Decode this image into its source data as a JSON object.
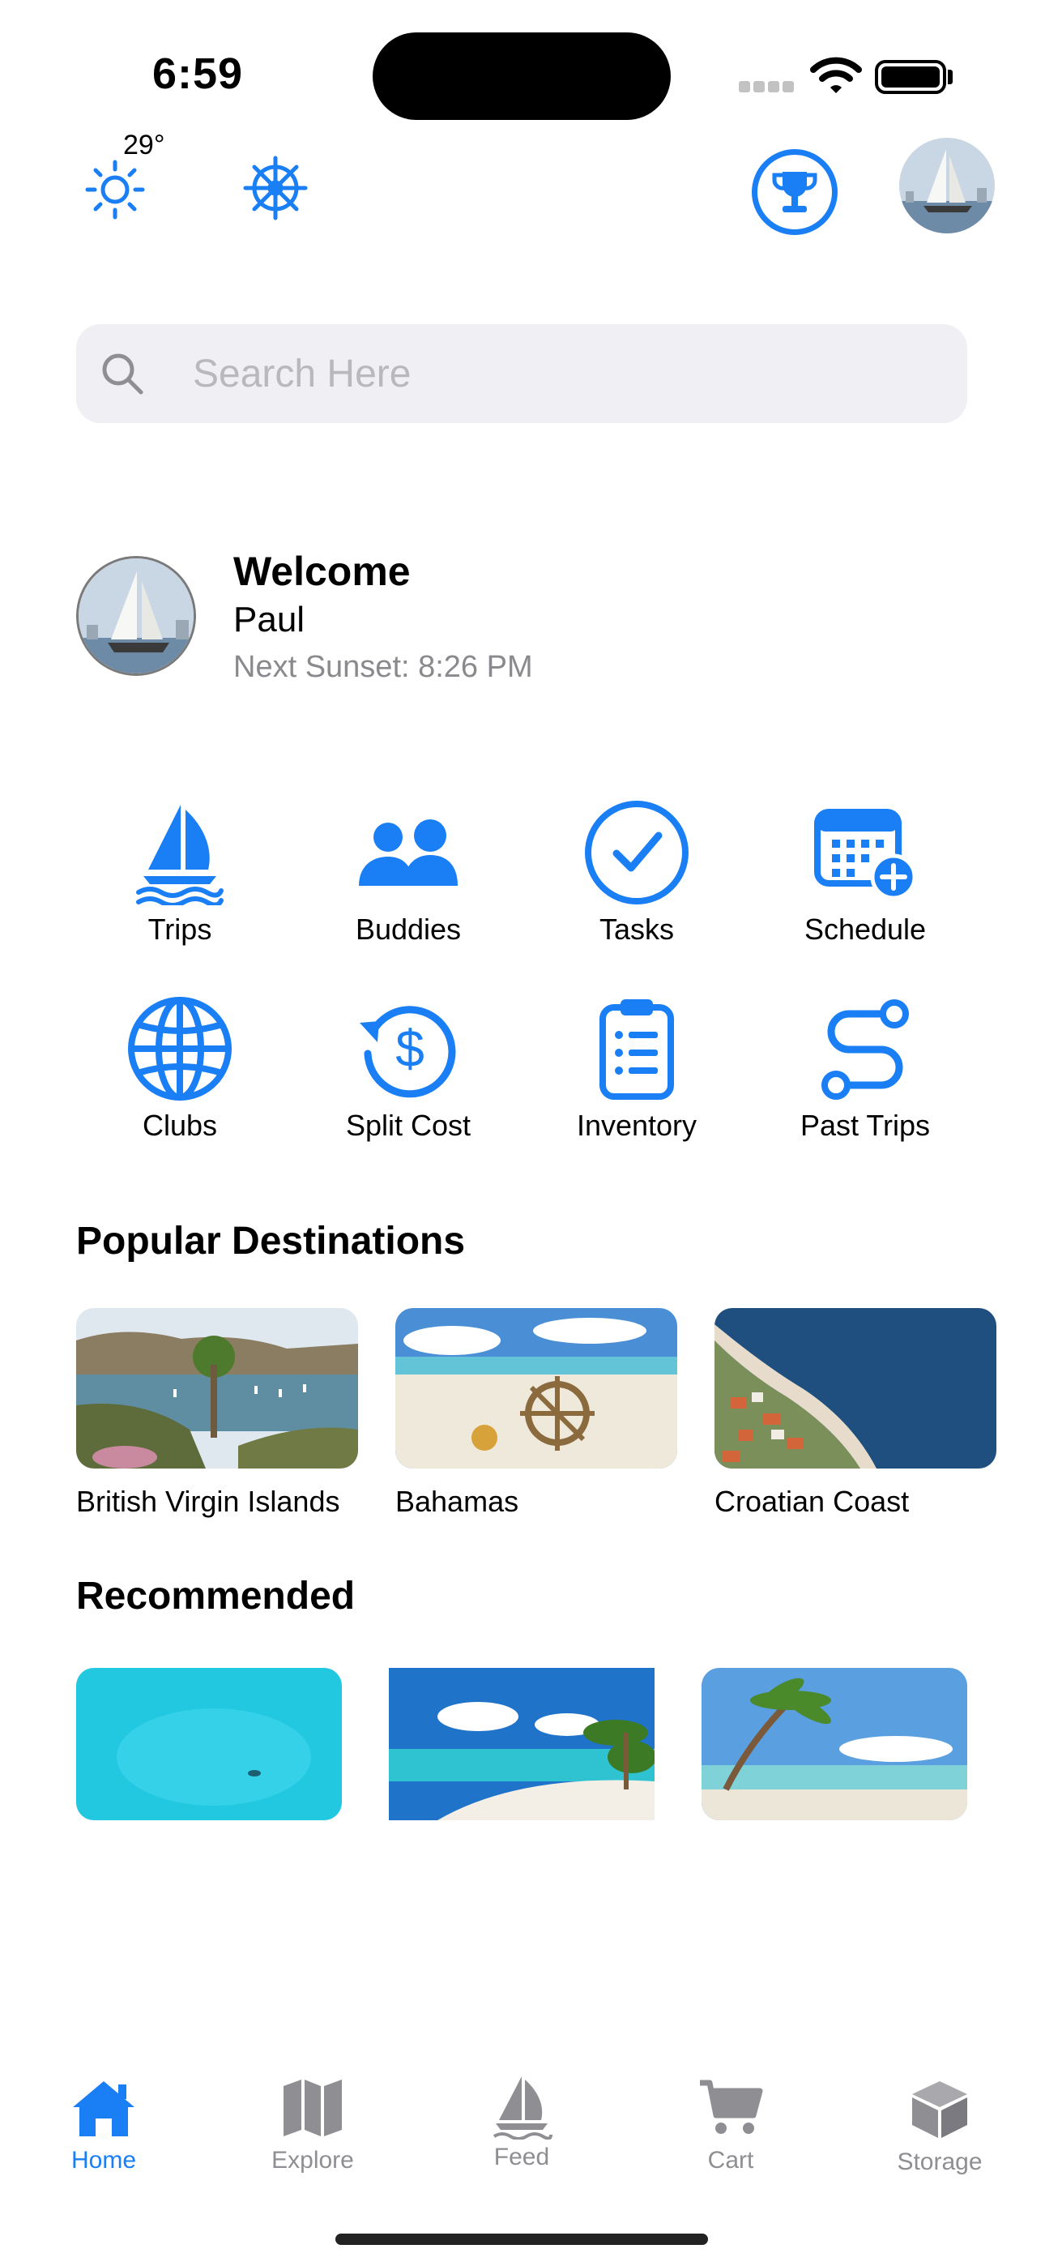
{
  "status_bar": {
    "time": "6:59"
  },
  "weather": {
    "temperature": "29°"
  },
  "search": {
    "placeholder": "Search Here"
  },
  "welcome": {
    "title": "Welcome",
    "name": "Paul",
    "sunset": "Next Sunset: 8:26 PM"
  },
  "features": [
    {
      "label": "Trips",
      "icon": "sailboat-icon"
    },
    {
      "label": "Buddies",
      "icon": "people-icon"
    },
    {
      "label": "Tasks",
      "icon": "checkmark-circle-icon"
    },
    {
      "label": "Schedule",
      "icon": "calendar-plus-icon"
    },
    {
      "label": "Clubs",
      "icon": "globe-icon"
    },
    {
      "label": "Split Cost",
      "icon": "dollar-refresh-icon"
    },
    {
      "label": "Inventory",
      "icon": "clipboard-list-icon"
    },
    {
      "label": "Past Trips",
      "icon": "route-icon"
    }
  ],
  "popular": {
    "title": "Popular Destinations",
    "items": [
      {
        "label": "British Virgin Islands"
      },
      {
        "label": "Bahamas"
      },
      {
        "label": "Croatian Coast"
      }
    ]
  },
  "recommended": {
    "title": "Recommended"
  },
  "tab_bar": {
    "items": [
      {
        "label": "Home",
        "icon": "house-icon",
        "active": true
      },
      {
        "label": "Explore",
        "icon": "map-icon",
        "active": false
      },
      {
        "label": "Feed",
        "icon": "sailboat-icon",
        "active": false
      },
      {
        "label": "Cart",
        "icon": "cart-icon",
        "active": false
      },
      {
        "label": "Storage",
        "icon": "box-icon",
        "active": false
      }
    ]
  },
  "colors": {
    "accent": "#1a7ff5",
    "inactive": "#8e8e93",
    "search_bg": "#efeff4"
  }
}
